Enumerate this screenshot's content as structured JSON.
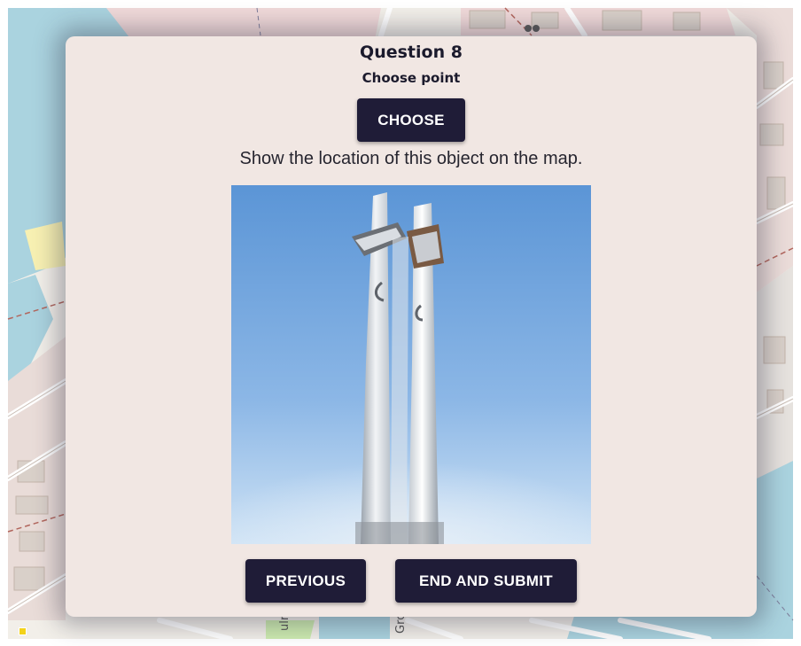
{
  "question": {
    "title": "Question 8",
    "subtitle": "Choose point",
    "instruction": "Show the location of this object on the map."
  },
  "buttons": {
    "choose_label": "CHOOSE",
    "previous_label": "PREVIOUS",
    "submit_label": "END AND SUBMIT"
  },
  "map": {
    "street_labels": [
      "ulny",
      "Grobl"
    ]
  },
  "colors": {
    "modal_bg": "#f1e7e3",
    "button_bg": "#1f1c37",
    "water": "#aad3df",
    "land": "#f2efe9",
    "built_area": "#f0d9d9"
  },
  "photo": {
    "subject": "three-crosses-monument-icon"
  }
}
